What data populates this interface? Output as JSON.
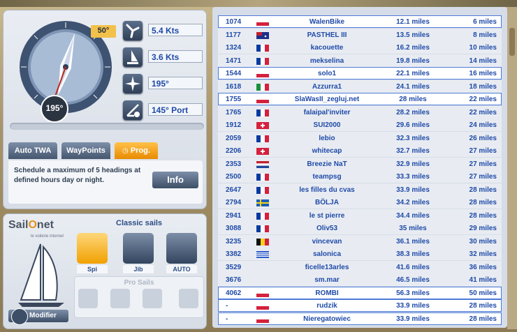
{
  "nav": {
    "heading_label": "195°",
    "twa_label": "50°",
    "wind_speed": "5.4 Kts",
    "boat_speed": "3.6 Kts",
    "heading": "195°",
    "twa": "145° Port",
    "tabs": [
      "Auto TWA",
      "WayPoints",
      "Prog."
    ],
    "info_text": "Schedule a maximum of 5 headings at defined hours day or night.",
    "info_button": "Info"
  },
  "sails": {
    "logo_a": "Sail",
    "logo_o": "O",
    "logo_b": "net",
    "logo_sub": "le voilerie internet",
    "classic_title": "Classic sails",
    "classic": [
      "Spi",
      "Jib",
      "AUTO"
    ],
    "pro_title": "Pro Sails",
    "modifier": "Modifier"
  },
  "colors": {
    "accent": "#e88a00",
    "link_blue": "#1f4aa8",
    "panel_blue": "#45566f"
  },
  "ranking": [
    {
      "rank": "1074",
      "flag": "pl",
      "name": "WalenBike",
      "dist": "12.1 miles",
      "gap": "6 miles",
      "style": "white"
    },
    {
      "rank": "1177",
      "flag": "au",
      "name": "PASTHEL III",
      "dist": "13.5 miles",
      "gap": "8 miles",
      "style": "gray"
    },
    {
      "rank": "1324",
      "flag": "fr",
      "name": "kacouette",
      "dist": "16.2 miles",
      "gap": "10 miles",
      "style": "gray"
    },
    {
      "rank": "1471",
      "flag": "fr",
      "name": "mekselina",
      "dist": "19.8 miles",
      "gap": "14 miles",
      "style": "gray"
    },
    {
      "rank": "1544",
      "flag": "pl",
      "name": "solo1",
      "dist": "22.1 miles",
      "gap": "16 miles",
      "style": "white"
    },
    {
      "rank": "1618",
      "flag": "it",
      "name": "Azzurra1",
      "dist": "24.1 miles",
      "gap": "18 miles",
      "style": "gray"
    },
    {
      "rank": "1755",
      "flag": "pl",
      "name": "SlaWasII_zegluj.net",
      "dist": "28 miles",
      "gap": "22 miles",
      "style": "white"
    },
    {
      "rank": "1765",
      "flag": "fr",
      "name": "falaipal'inviter",
      "dist": "28.2 miles",
      "gap": "22 miles",
      "style": "gray"
    },
    {
      "rank": "1912",
      "flag": "ch",
      "name": "SUI2000",
      "dist": "29.6 miles",
      "gap": "24 miles",
      "style": "gray"
    },
    {
      "rank": "2059",
      "flag": "fr",
      "name": "lebio",
      "dist": "32.3 miles",
      "gap": "26 miles",
      "style": "gray"
    },
    {
      "rank": "2206",
      "flag": "ch",
      "name": "whitecap",
      "dist": "32.7 miles",
      "gap": "27 miles",
      "style": "gray"
    },
    {
      "rank": "2353",
      "flag": "nl",
      "name": "Breezie NaT",
      "dist": "32.9 miles",
      "gap": "27 miles",
      "style": "gray"
    },
    {
      "rank": "2500",
      "flag": "fr",
      "name": "teampsg",
      "dist": "33.3 miles",
      "gap": "27 miles",
      "style": "gray"
    },
    {
      "rank": "2647",
      "flag": "fr",
      "name": "les filles du cvas",
      "dist": "33.9 miles",
      "gap": "28 miles",
      "style": "gray"
    },
    {
      "rank": "2794",
      "flag": "se",
      "name": "BÖLJA",
      "dist": "34.2 miles",
      "gap": "28 miles",
      "style": "gray"
    },
    {
      "rank": "2941",
      "flag": "fr",
      "name": "le st pierre",
      "dist": "34.4 miles",
      "gap": "28 miles",
      "style": "gray"
    },
    {
      "rank": "3088",
      "flag": "fr",
      "name": "Oliv53",
      "dist": "35 miles",
      "gap": "29 miles",
      "style": "gray"
    },
    {
      "rank": "3235",
      "flag": "be",
      "name": "vincevan",
      "dist": "36.1 miles",
      "gap": "30 miles",
      "style": "gray"
    },
    {
      "rank": "3382",
      "flag": "gr",
      "name": "salonica",
      "dist": "38.3 miles",
      "gap": "32 miles",
      "style": "gray"
    },
    {
      "rank": "3529",
      "flag": "",
      "name": "ficelle13arles",
      "dist": "41.6 miles",
      "gap": "36 miles",
      "style": "gray"
    },
    {
      "rank": "3676",
      "flag": "",
      "name": "sm.mar",
      "dist": "46.5 miles",
      "gap": "41 miles",
      "style": "gray"
    },
    {
      "rank": "4062",
      "flag": "pl",
      "name": "ROMBI",
      "dist": "56.3 miles",
      "gap": "50 miles",
      "style": "white"
    },
    {
      "rank": "-",
      "flag": "pl",
      "name": "rudzik",
      "dist": "33.9 miles",
      "gap": "28 miles",
      "style": "white"
    },
    {
      "rank": "-",
      "flag": "pl",
      "name": "Nieregatowiec",
      "dist": "33.9 miles",
      "gap": "28 miles",
      "style": "white"
    }
  ]
}
